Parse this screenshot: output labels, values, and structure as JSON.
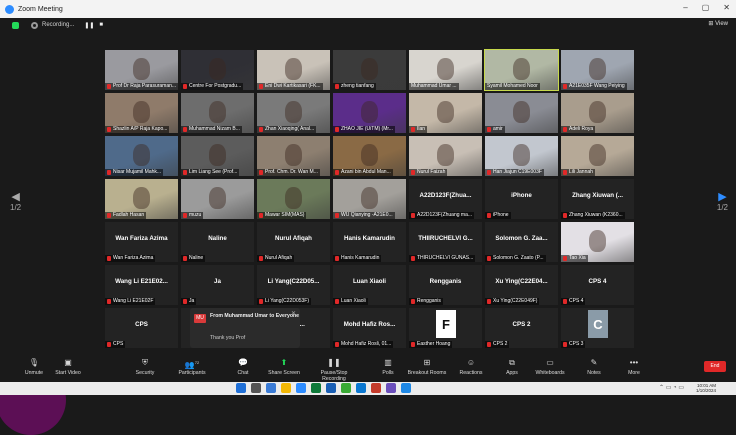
{
  "window": {
    "title": "Zoom Meeting",
    "minimize": "–",
    "maximize": "▢",
    "close": "✕"
  },
  "recording": {
    "label": "Recording...",
    "pause": "❚❚",
    "stop": "■"
  },
  "view_label": "View",
  "pager": {
    "left_text": "1/2",
    "right_text": "1/2"
  },
  "colors": {
    "mic_muted": "#e02828",
    "active_speaker": "#c7d94c",
    "share_green": "#23d959",
    "end_red": "#e02828"
  },
  "tiles": [
    {
      "label": "Prof Dr Raja Parasuraman...",
      "video": true,
      "bg": "#9a9a9f"
    },
    {
      "label": "Centre For Postgradu...",
      "video": true,
      "bg": "#2f2f35"
    },
    {
      "label": "Eni Dwi Kartikasari (FK...",
      "video": true,
      "bg": "#c9c2b8"
    },
    {
      "label": "zheng tianfang",
      "video": true,
      "bg": "#3b3b3b"
    },
    {
      "label": "Muhammad Umar ...",
      "video": true,
      "bg": "#d8d5cf",
      "mic": false
    },
    {
      "label": "Syamil Mohamed Noor",
      "video": true,
      "bg": "#b1b8a4",
      "active": true,
      "mic": false
    },
    {
      "label": "A21E035F Wang Peiying",
      "video": true,
      "bg": "#9fa6b1"
    },
    {
      "label": "Shazlin A/P Raja Kapo...",
      "video": true,
      "bg": "#8f7b6a"
    },
    {
      "label": "Muhammad Nizam B...",
      "video": true,
      "bg": "#6d6d6d"
    },
    {
      "label": "Zhan Xiaoqing( Anal...",
      "video": true,
      "bg": "#7a7a7a"
    },
    {
      "label": "ZHAO JIE (UiTM) (Mr...",
      "video": true,
      "bg": "#5b2d8a"
    },
    {
      "label": "Ilan",
      "video": true,
      "bg": "#c4b8a8"
    },
    {
      "label": "amir",
      "video": true,
      "bg": "#8a8c94"
    },
    {
      "label": "Adeli Roya",
      "video": true,
      "bg": "#a99d8d"
    },
    {
      "label": "Nisar Mujamil Mahk...",
      "video": true,
      "bg": "#4f6a8a"
    },
    {
      "label": "Lim Liang See (Prof...",
      "video": true,
      "bg": "#5c5c5c"
    },
    {
      "label": "Prof. Chm. Dr. Wan M...",
      "video": true,
      "bg": "#8d7f70"
    },
    {
      "label": "Azani bin Abdul Man...",
      "video": true,
      "bg": "#8a6a45"
    },
    {
      "label": "Nurul Faizah",
      "video": true,
      "bg": "#c8bfb5"
    },
    {
      "label": "Han Jiajun C19E003F",
      "video": true,
      "bg": "#c2c7cf"
    },
    {
      "label": "Lili Jannah",
      "video": true,
      "bg": "#b6a997"
    },
    {
      "label": "Fadlah Hasan",
      "video": true,
      "bg": "#b9b08f"
    },
    {
      "label": "muzu",
      "video": true,
      "bg": "#9b9b9b"
    },
    {
      "label": "Mawar SIM(MAS)",
      "video": true,
      "bg": "#6b7a5a"
    },
    {
      "label": "WU Qianying -A21E0...",
      "video": true,
      "bg": "#a3a09b"
    },
    {
      "label": "A22D123F(Zhuang ma...",
      "name": "A22D123F(Zhua...",
      "video": false
    },
    {
      "label": "iPhone",
      "name": "iPhone",
      "video": false
    },
    {
      "label": "Zhang Xiuwan (K2360...",
      "name": "Zhang Xiuwan (...",
      "video": false
    },
    {
      "label": "Wan Fariza Azima",
      "name": "Wan Fariza Azima",
      "video": false
    },
    {
      "label": "Naline",
      "name": "Naline",
      "video": false
    },
    {
      "label": "Nurul Afiqah",
      "name": "Nurul Afiqah",
      "video": false
    },
    {
      "label": "Hanis Kamarudin",
      "name": "Hanis Kamarudin",
      "video": false
    },
    {
      "label": "THIRUCHELVI GUNAS...",
      "name": "THIIRUCHELVI G...",
      "video": false
    },
    {
      "label": "Solomon G. Zaato (P...",
      "name": "Solomon G. Zaa...",
      "video": false
    },
    {
      "label": "Tao Xia",
      "video": true,
      "bg": "#e3e0e5"
    },
    {
      "label": "Wang Li E21E02F",
      "name": "Wang Li E21E02...",
      "video": false
    },
    {
      "label": "Ja",
      "name": "Ja",
      "video": false
    },
    {
      "label": "Li Yang(C22D053F)",
      "name": "Li Yang(C22D05...",
      "video": false
    },
    {
      "label": "Luan Xiaoli",
      "name": "Luan Xiaoli",
      "video": false
    },
    {
      "label": "Rengganis",
      "name": "Rengganis",
      "video": false
    },
    {
      "label": "Xu Ying(C22E049F)",
      "name": "Xu Ying(C22E04...",
      "video": false
    },
    {
      "label": "CPS 4",
      "name": "CPS 4",
      "video": false
    },
    {
      "label": "CPS",
      "name": "CPS",
      "video": false
    },
    {
      "label": "",
      "name": "",
      "video": false
    },
    {
      "label": "Nur Iazim E...",
      "name": "Nur Ia...",
      "video": false
    },
    {
      "label": "Mohd Hafiz Rosli, 01...",
      "name": "Mohd Hafiz Ros...",
      "video": false
    },
    {
      "label": "Easther Hoang",
      "avatar": "F",
      "video": false,
      "avatar_bg": "#ffffff",
      "avatar_fg": "#111111"
    },
    {
      "label": "CPS 2",
      "name": "CPS 2",
      "video": false
    },
    {
      "label": "CPS 3",
      "avatar": "C",
      "video": false,
      "avatar_bg": "#8a9ba8",
      "avatar_fg": "#ffffff"
    }
  ],
  "chat": {
    "badge": "MU",
    "from": "From Muhammad Umar to Everyone",
    "message": "Thank you Prof",
    "close": "✕"
  },
  "bottom_toolbar": [
    {
      "label": "Unmute",
      "icon": "mic-icon"
    },
    {
      "label": "Start Video",
      "icon": "camera-icon"
    },
    {
      "label": "Security",
      "icon": "shield-icon"
    },
    {
      "label": "Participants",
      "icon": "people-icon",
      "count": "72"
    },
    {
      "label": "Chat",
      "icon": "chat-icon"
    },
    {
      "label": "Share Screen",
      "icon": "share-icon"
    },
    {
      "label": "Pause/Stop Recording",
      "icon": "record-icon"
    },
    {
      "label": "Polls",
      "icon": "polls-icon"
    },
    {
      "label": "Breakout Rooms",
      "icon": "rooms-icon"
    },
    {
      "label": "Reactions",
      "icon": "reaction-icon"
    },
    {
      "label": "Apps",
      "icon": "apps-icon"
    },
    {
      "label": "Whiteboards",
      "icon": "whiteboard-icon"
    },
    {
      "label": "Notes",
      "icon": "notes-icon"
    },
    {
      "label": "More",
      "icon": "more-icon"
    }
  ],
  "end_label": "End",
  "tray": {
    "time": "10:01 AM",
    "date": "1/10/2024"
  }
}
